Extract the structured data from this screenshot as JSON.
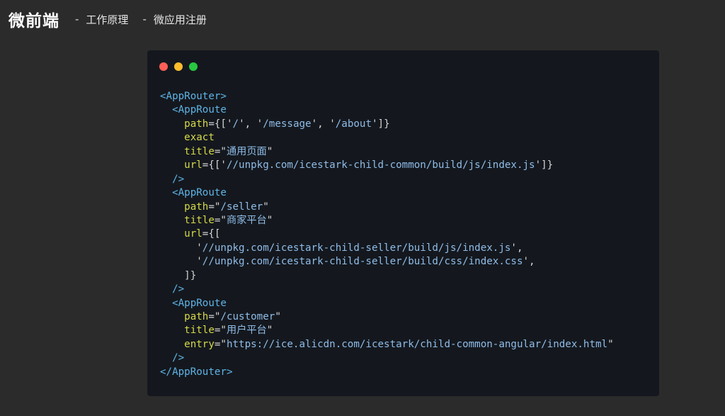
{
  "header": {
    "title": "微前端",
    "breadcrumbs": [
      {
        "separator": "-",
        "label": "工作原理"
      },
      {
        "separator": "-",
        "label": "微应用注册"
      }
    ]
  },
  "window_controls": [
    {
      "name": "close",
      "color": "#ff5f57"
    },
    {
      "name": "minimize",
      "color": "#febc2e"
    },
    {
      "name": "maximize",
      "color": "#28c840"
    }
  ],
  "code": {
    "lines": [
      [
        {
          "t": "tag",
          "v": "<AppRouter>"
        }
      ],
      [
        {
          "t": "tag",
          "v": "  <AppRoute"
        }
      ],
      [
        {
          "t": "attr",
          "v": "    path"
        },
        {
          "t": "punc",
          "v": "={['"
        },
        {
          "t": "str",
          "v": "/"
        },
        {
          "t": "punc",
          "v": "', '"
        },
        {
          "t": "str",
          "v": "/message"
        },
        {
          "t": "punc",
          "v": "', '"
        },
        {
          "t": "str",
          "v": "/about"
        },
        {
          "t": "punc",
          "v": "']}"
        }
      ],
      [
        {
          "t": "attr",
          "v": "    exact"
        }
      ],
      [
        {
          "t": "attr",
          "v": "    title"
        },
        {
          "t": "punc",
          "v": "=\""
        },
        {
          "t": "str",
          "v": "通用页面"
        },
        {
          "t": "punc",
          "v": "\""
        }
      ],
      [
        {
          "t": "attr",
          "v": "    url"
        },
        {
          "t": "punc",
          "v": "={['"
        },
        {
          "t": "str",
          "v": "//unpkg.com/icestark-child-common/build/js/index.js"
        },
        {
          "t": "punc",
          "v": "']}"
        }
      ],
      [
        {
          "t": "tag",
          "v": "  />"
        }
      ],
      [
        {
          "t": "tag",
          "v": "  <AppRoute"
        }
      ],
      [
        {
          "t": "attr",
          "v": "    path"
        },
        {
          "t": "punc",
          "v": "=\""
        },
        {
          "t": "str",
          "v": "/seller"
        },
        {
          "t": "punc",
          "v": "\""
        }
      ],
      [
        {
          "t": "attr",
          "v": "    title"
        },
        {
          "t": "punc",
          "v": "=\""
        },
        {
          "t": "str",
          "v": "商家平台"
        },
        {
          "t": "punc",
          "v": "\""
        }
      ],
      [
        {
          "t": "attr",
          "v": "    url"
        },
        {
          "t": "punc",
          "v": "={["
        }
      ],
      [
        {
          "t": "punc",
          "v": "      '"
        },
        {
          "t": "str",
          "v": "//unpkg.com/icestark-child-seller/build/js/index.js"
        },
        {
          "t": "punc",
          "v": "',"
        }
      ],
      [
        {
          "t": "punc",
          "v": "      '"
        },
        {
          "t": "str",
          "v": "//unpkg.com/icestark-child-seller/build/css/index.css"
        },
        {
          "t": "punc",
          "v": "',"
        }
      ],
      [
        {
          "t": "punc",
          "v": "    ]}"
        }
      ],
      [
        {
          "t": "tag",
          "v": "  />"
        }
      ],
      [
        {
          "t": "tag",
          "v": "  <AppRoute"
        }
      ],
      [
        {
          "t": "attr",
          "v": "    path"
        },
        {
          "t": "punc",
          "v": "=\""
        },
        {
          "t": "str",
          "v": "/customer"
        },
        {
          "t": "punc",
          "v": "\""
        }
      ],
      [
        {
          "t": "attr",
          "v": "    title"
        },
        {
          "t": "punc",
          "v": "=\""
        },
        {
          "t": "str",
          "v": "用户平台"
        },
        {
          "t": "punc",
          "v": "\""
        }
      ],
      [
        {
          "t": "attr",
          "v": "    entry"
        },
        {
          "t": "punc",
          "v": "=\""
        },
        {
          "t": "str",
          "v": "https://ice.alicdn.com/icestark/child-common-angular/index.html"
        },
        {
          "t": "punc",
          "v": "\""
        }
      ],
      [
        {
          "t": "tag",
          "v": "  />"
        }
      ],
      [
        {
          "t": "tag",
          "v": "</AppRouter>"
        }
      ]
    ]
  }
}
